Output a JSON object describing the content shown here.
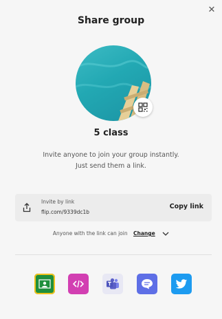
{
  "dialog": {
    "title": "Share group",
    "close_icon": "close-icon",
    "group_name": "5 class",
    "description_line1": "Invite anyone to join your group instantly.",
    "description_line2": "Just send them a link."
  },
  "invite": {
    "label": "Invite by link",
    "url": "flip.com/9339dc1b",
    "copy_label": "Copy link"
  },
  "permission": {
    "text": "Anyone with the link can join",
    "change_label": "Change"
  },
  "share_targets": [
    {
      "icon": "google-classroom-icon",
      "color": "#1f8f3c"
    },
    {
      "icon": "embed-code-icon",
      "color": "#d23fb2"
    },
    {
      "icon": "microsoft-teams-icon",
      "color": "#5b5fc7"
    },
    {
      "icon": "remind-icon",
      "color": "#5e6fe6"
    },
    {
      "icon": "twitter-icon",
      "color": "#1d9bf0"
    }
  ]
}
